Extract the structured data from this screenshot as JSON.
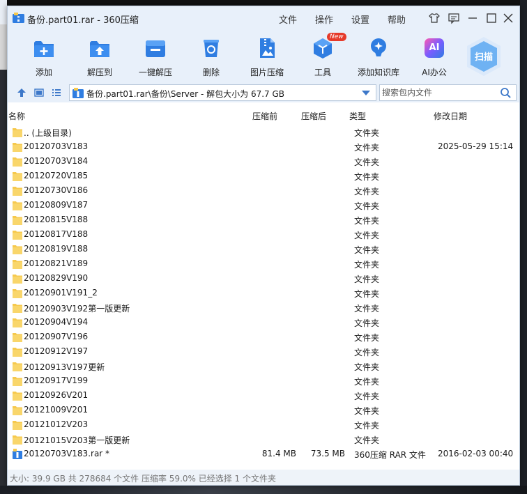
{
  "window": {
    "title": "备份.part01.rar - 360压缩",
    "menu": [
      "文件",
      "操作",
      "设置",
      "帮助"
    ]
  },
  "toolbar": {
    "tools": [
      {
        "label": "添加",
        "icon": "add-icon"
      },
      {
        "label": "解压到",
        "icon": "extract-to-icon"
      },
      {
        "label": "一键解压",
        "icon": "one-click-extract-icon"
      },
      {
        "label": "删除",
        "icon": "trash-icon"
      },
      {
        "label": "图片压缩",
        "icon": "image-compress-icon"
      },
      {
        "label": "工具",
        "icon": "tools-icon",
        "badge": "New"
      },
      {
        "label": "添加知识库",
        "icon": "knowledge-base-icon"
      },
      {
        "label": "AI办公",
        "icon": "ai-office-icon",
        "glyph": "AI"
      }
    ],
    "scan_label": "扫描"
  },
  "address": {
    "path": "备份.part01.rar\\备份\\Server - 解包大小为 67.7 GB",
    "search_placeholder": "搜索包内文件"
  },
  "columns": {
    "name": "名称",
    "compressed_before": "压缩前",
    "compressed_after": "压缩后",
    "type": "类型",
    "modified": "修改日期"
  },
  "files": [
    {
      "name": ".. (上级目录)",
      "type": "文件夹",
      "date": "",
      "before": "",
      "after": "",
      "kind": "folder"
    },
    {
      "name": "20120703V183",
      "type": "文件夹",
      "date": "2025-05-29 15:14",
      "before": "",
      "after": "",
      "kind": "folder"
    },
    {
      "name": "20120703V184",
      "type": "文件夹",
      "date": "",
      "before": "",
      "after": "",
      "kind": "folder"
    },
    {
      "name": "20120720V185",
      "type": "文件夹",
      "date": "",
      "before": "",
      "after": "",
      "kind": "folder"
    },
    {
      "name": "20120730V186",
      "type": "文件夹",
      "date": "",
      "before": "",
      "after": "",
      "kind": "folder"
    },
    {
      "name": "20120809V187",
      "type": "文件夹",
      "date": "",
      "before": "",
      "after": "",
      "kind": "folder"
    },
    {
      "name": "20120815V188",
      "type": "文件夹",
      "date": "",
      "before": "",
      "after": "",
      "kind": "folder"
    },
    {
      "name": "20120817V188",
      "type": "文件夹",
      "date": "",
      "before": "",
      "after": "",
      "kind": "folder"
    },
    {
      "name": "20120819V188",
      "type": "文件夹",
      "date": "",
      "before": "",
      "after": "",
      "kind": "folder"
    },
    {
      "name": "20120821V189",
      "type": "文件夹",
      "date": "",
      "before": "",
      "after": "",
      "kind": "folder"
    },
    {
      "name": "20120829V190",
      "type": "文件夹",
      "date": "",
      "before": "",
      "after": "",
      "kind": "folder"
    },
    {
      "name": "20120901V191_2",
      "type": "文件夹",
      "date": "",
      "before": "",
      "after": "",
      "kind": "folder"
    },
    {
      "name": "20120903V192第一版更新",
      "type": "文件夹",
      "date": "",
      "before": "",
      "after": "",
      "kind": "folder"
    },
    {
      "name": "20120904V194",
      "type": "文件夹",
      "date": "",
      "before": "",
      "after": "",
      "kind": "folder"
    },
    {
      "name": "20120907V196",
      "type": "文件夹",
      "date": "",
      "before": "",
      "after": "",
      "kind": "folder"
    },
    {
      "name": "20120912V197",
      "type": "文件夹",
      "date": "",
      "before": "",
      "after": "",
      "kind": "folder"
    },
    {
      "name": "20120913V197更新",
      "type": "文件夹",
      "date": "",
      "before": "",
      "after": "",
      "kind": "folder"
    },
    {
      "name": "20120917V199",
      "type": "文件夹",
      "date": "",
      "before": "",
      "after": "",
      "kind": "folder"
    },
    {
      "name": "20120926V201",
      "type": "文件夹",
      "date": "",
      "before": "",
      "after": "",
      "kind": "folder"
    },
    {
      "name": "20121009V201",
      "type": "文件夹",
      "date": "",
      "before": "",
      "after": "",
      "kind": "folder"
    },
    {
      "name": "20121012V203",
      "type": "文件夹",
      "date": "",
      "before": "",
      "after": "",
      "kind": "folder"
    },
    {
      "name": "20121015V203第一版更新",
      "type": "文件夹",
      "date": "",
      "before": "",
      "after": "",
      "kind": "folder"
    },
    {
      "name": "20120703V183.rar *",
      "type": "360压缩 RAR 文件",
      "date": "2016-02-03 00:40",
      "before": "81.4 MB",
      "after": "73.5 MB",
      "kind": "rar"
    }
  ],
  "status": "大小: 39.9 GB 共 278684 个文件 压缩率 59.0% 已经选择 1 个文件夹",
  "colors": {
    "chrome": "#e8f0fa",
    "accent": "#2f7de1",
    "folder": "#f6c94e",
    "badge": "#e63a2a"
  }
}
